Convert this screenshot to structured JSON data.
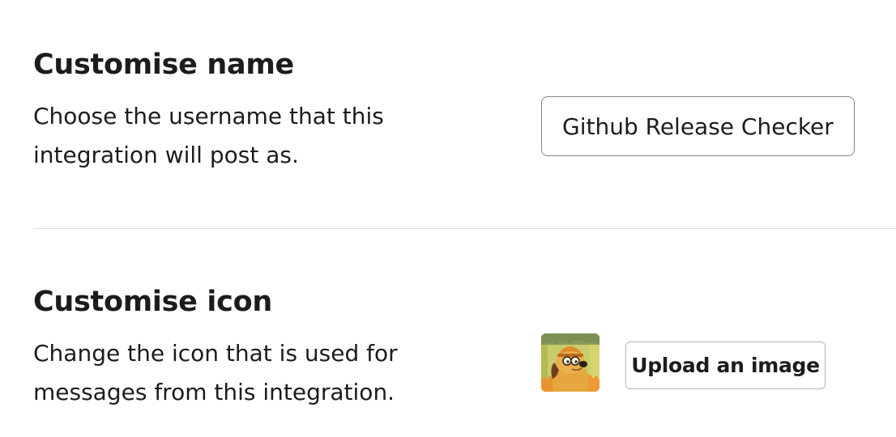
{
  "name_section": {
    "title": "Customise name",
    "description": "Choose the username that this integration will post as.",
    "input_value": "Github Release Checker"
  },
  "icon_section": {
    "title": "Customise icon",
    "description": "Change the icon that is used for messages from this integration.",
    "avatar_icon": "this-is-fine-dog-icon",
    "upload_label": "Upload an image"
  },
  "colors": {
    "text": "#1d1c1d",
    "input_border": "#868686",
    "button_border": "#b5b5b5",
    "divider": "#dddddd"
  }
}
